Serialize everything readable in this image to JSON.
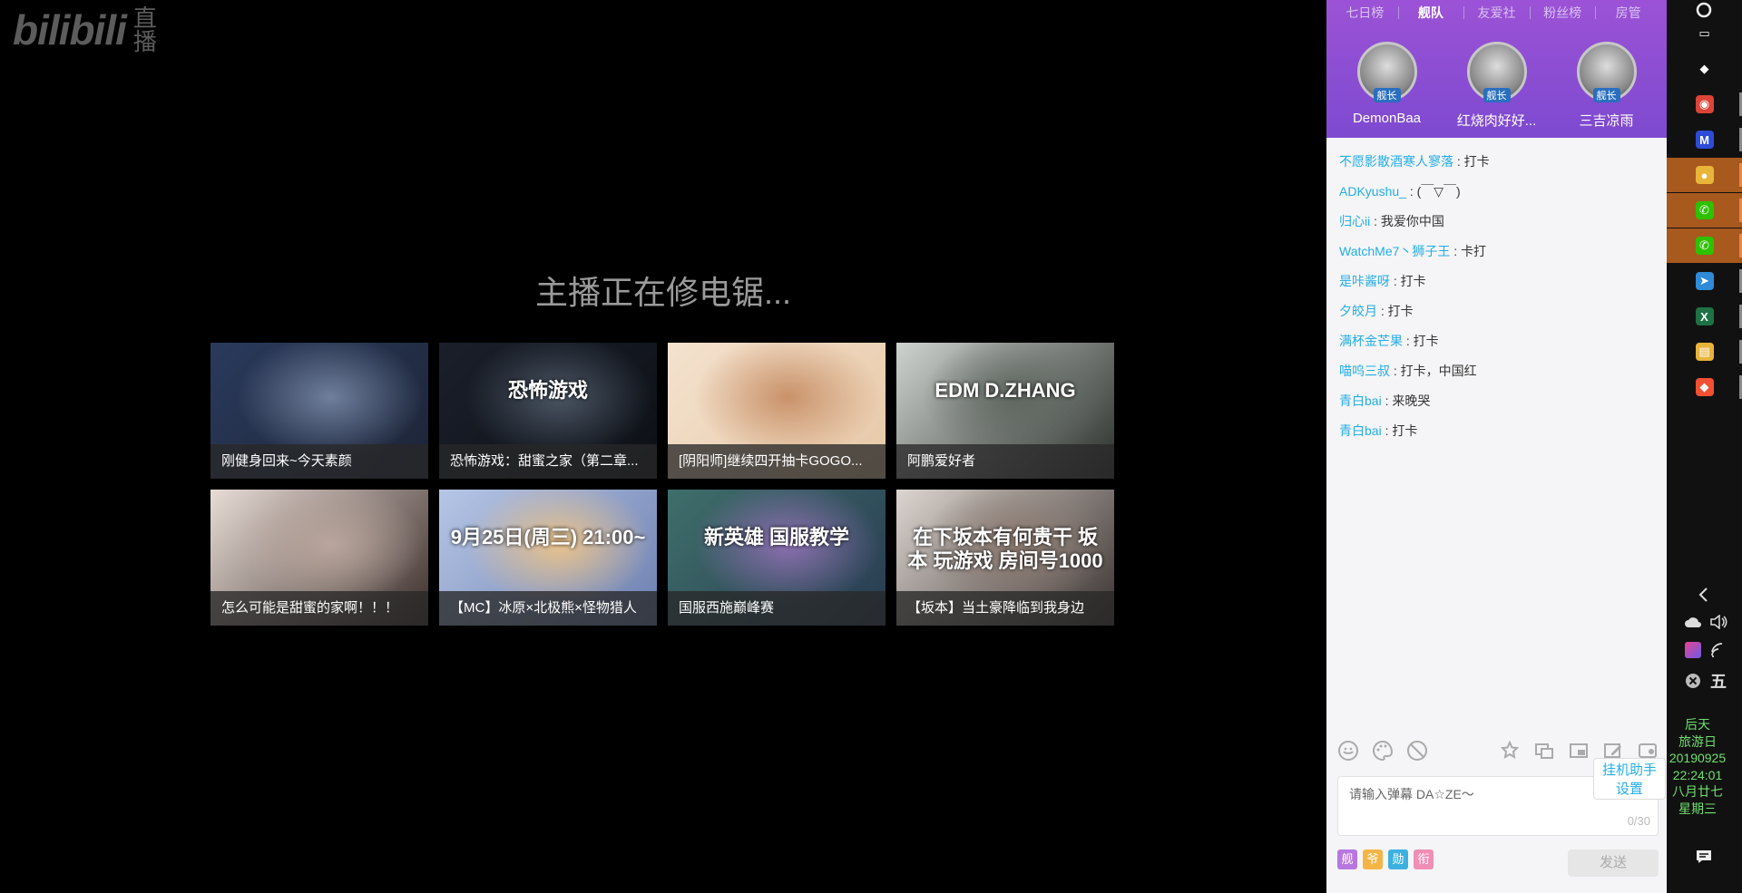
{
  "logo": {
    "brand": "bilibili",
    "suffix": "直播"
  },
  "offline_message": "主播正在修电锯...",
  "recommendations": [
    {
      "title": "刚健身回来~今天素颜",
      "bg": [
        "#2a3a5c",
        "#6f7f9c",
        "#1d2436"
      ]
    },
    {
      "title": "恐怖游戏：甜蜜之家（第二章...",
      "bg": [
        "#1a1f2a",
        "#4a5563",
        "#0d1016"
      ],
      "overlay": "恐怖游戏"
    },
    {
      "title": "[阴阳师]继续四开抽卡GOGO...",
      "bg": [
        "#f4e2cf",
        "#c9926a",
        "#e7c8a6"
      ]
    },
    {
      "title": "阿鹏爱好者",
      "bg": [
        "#cfd3cf",
        "#5f6760",
        "#2a2f2b"
      ],
      "overlay": "EDM  D.ZHANG"
    },
    {
      "title": "怎么可能是甜蜜的家啊！！！",
      "bg": [
        "#e8dcd6",
        "#b9a59c",
        "#3a2d2a"
      ]
    },
    {
      "title": "【MC】冰原×北极熊×怪物猎人",
      "bg": [
        "#b6c6e6",
        "#e9c28a",
        "#6d7fb0"
      ],
      "overlay": "9月25日(周三) 21:00~"
    },
    {
      "title": "国服西施巅峰赛",
      "bg": [
        "#3f6f6a",
        "#8c6fb0",
        "#283a52"
      ],
      "overlay": "新英雄 国服教学"
    },
    {
      "title": "【坂本】当土豪降临到我身边",
      "bg": [
        "#dcd5d0",
        "#8b7a70",
        "#3a3230"
      ],
      "overlay": "在下坂本有何贵干 坂本 玩游戏 房间号1000"
    }
  ],
  "panel": {
    "tabs": [
      "七日榜",
      "舰队",
      "友爱社",
      "粉丝榜",
      "房管"
    ],
    "active_tab": "舰队",
    "captains": [
      {
        "name": "DemonBaa",
        "badge": "舰长"
      },
      {
        "name": "红烧肉好好...",
        "badge": "舰长"
      },
      {
        "name": "三吉凉雨",
        "badge": "舰长"
      }
    ],
    "messages": [
      {
        "user": "不愿影散酒寒人寥落",
        "text": "打卡"
      },
      {
        "user": "ADKyushu_",
        "text": "(￣▽￣)"
      },
      {
        "user": "归心ii",
        "text": "我爱你中国"
      },
      {
        "user": "WatchMe7丶狮子王",
        "text": "卡打"
      },
      {
        "user": "是咔酱呀",
        "text": "打卡"
      },
      {
        "user": "夕皎月",
        "text": "打卡"
      },
      {
        "user": "满杯金芒果",
        "text": "打卡"
      },
      {
        "user": "喵呜三叔",
        "text": "打卡，中国红"
      },
      {
        "user": "青白bai",
        "text": "来晚哭"
      },
      {
        "user": "青白bai",
        "text": "打卡"
      }
    ],
    "helper": {
      "line1": "挂机助手",
      "line2": "设置"
    },
    "input": {
      "placeholder": "请输入弹幕 DA☆ZE～",
      "counter": "0/30"
    },
    "medals": [
      {
        "label": "舰",
        "color": "#b877e0"
      },
      {
        "label": "爷",
        "color": "#f4b547"
      },
      {
        "label": "勋",
        "color": "#3cb1e0"
      },
      {
        "label": "衔",
        "color": "#f08eb6"
      }
    ],
    "send_label": "发送"
  },
  "taskbar": {
    "apps": [
      {
        "name": "app-window-icon",
        "glyph": "▭",
        "color": "#111"
      },
      {
        "name": "fox-app-icon",
        "glyph": "◆",
        "color": "#111"
      },
      {
        "name": "chrome-icon",
        "glyph": "◉",
        "color": "#db4437"
      },
      {
        "name": "m-app-icon",
        "glyph": "M",
        "color": "#2d4bd8"
      },
      {
        "name": "bilibili-live-icon",
        "glyph": "●",
        "color": "#e8b43a"
      },
      {
        "name": "wechat-icon",
        "glyph": "✆",
        "color": "#2dc100"
      },
      {
        "name": "wechat-icon",
        "glyph": "✆",
        "color": "#2dc100"
      },
      {
        "name": "feishu-icon",
        "glyph": "➤",
        "color": "#2f8bd8"
      },
      {
        "name": "excel-icon",
        "glyph": "X",
        "color": "#1e7145"
      },
      {
        "name": "file-explorer-icon",
        "glyph": "▤",
        "color": "#e8b43a"
      },
      {
        "name": "git-icon",
        "glyph": "◆",
        "color": "#f05133"
      }
    ],
    "ime": "五",
    "clock": [
      "后天",
      "旅游日",
      "20190925",
      "22:24:01",
      "八月廿七",
      "星期三"
    ]
  }
}
